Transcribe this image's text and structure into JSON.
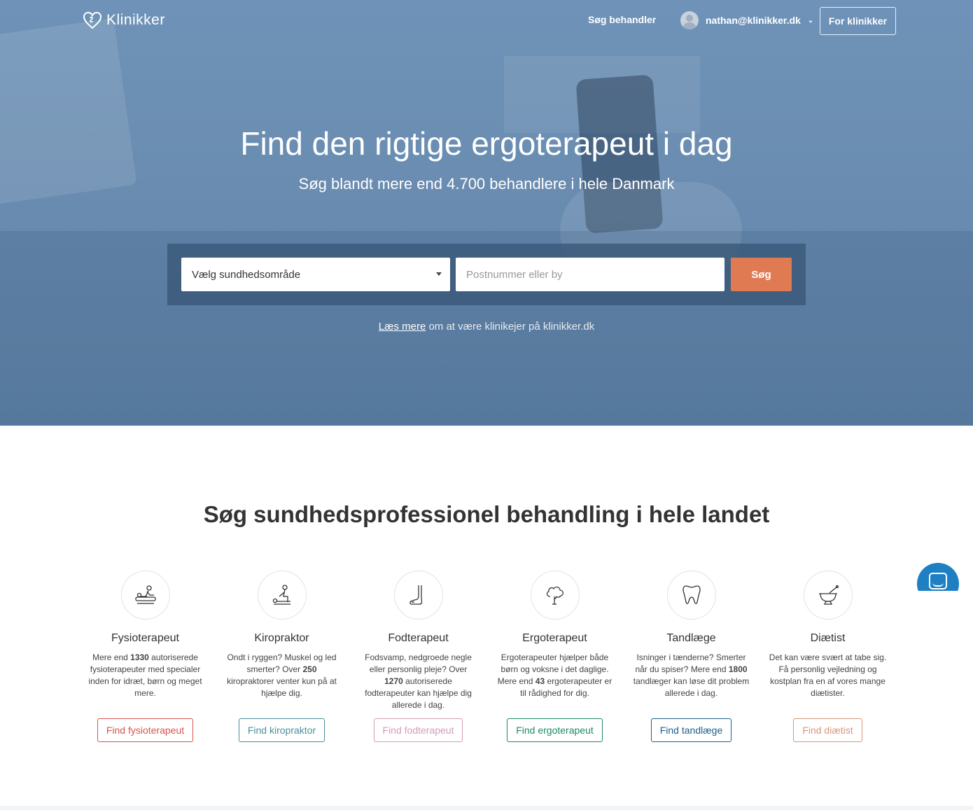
{
  "nav": {
    "logo_text": "Klinikker",
    "search_link": "Søg behandler",
    "user_email": "nathan@klinikker.dk",
    "clinic_button": "For klinikker"
  },
  "hero": {
    "title": "Find den rigtige ergoterapeut i dag",
    "subtitle": "Søg blandt mere end 4.700 behandlere i hele Danmark",
    "select_value": "Vælg sundhedsområde",
    "input_placeholder": "Postnummer eller by",
    "search_button": "Søg",
    "readmore_link": "Læs mere",
    "readmore_text": " om at være klinikejer på klinikker.dk"
  },
  "section": {
    "title": "Søg sundhedsprofessionel behandling i hele landet"
  },
  "cards": [
    {
      "icon": "massage-icon",
      "title": "Fysioterapeut",
      "desc": [
        "Mere end ",
        "1330",
        " autoriserede fysioterapeuter med specialer inden for idræt, børn og meget mere."
      ],
      "button": "Find fysioterapeut",
      "color": "#d9534f"
    },
    {
      "icon": "chiropractor-icon",
      "title": "Kiropraktor",
      "desc": [
        "Ondt i ryggen? Muskel og led smerter? Over ",
        "250",
        " kiropraktorer venter kun på at hjælpe dig."
      ],
      "button": "Find kiropraktor",
      "color": "#4a8f9a"
    },
    {
      "icon": "foot-icon",
      "title": "Fodterapeut",
      "desc": [
        "Fodsvamp, nedgroede negle eller personlig pleje? Over ",
        "1270",
        " autoriserede fodterapeuter kan hjælpe dig allerede i dag."
      ],
      "button": "Find fodterapeut",
      "color": "#d39bb8"
    },
    {
      "icon": "tree-icon",
      "title": "Ergoterapeut",
      "desc": [
        "Ergoterapeuter hjælper både børn og voksne i det daglige. Mere end ",
        "43",
        " ergoterapeuter er til rådighed for dig."
      ],
      "button": "Find ergoterapeut",
      "color": "#1f8a65"
    },
    {
      "icon": "tooth-icon",
      "title": "Tandlæge",
      "desc": [
        "Isninger i tænderne? Smerter når du spiser? Mere end ",
        "1800",
        " tandlæger kan løse dit problem allerede i dag."
      ],
      "button": "Find tandlæge",
      "color": "#1d5f8a"
    },
    {
      "icon": "mortar-pestle-icon",
      "title": "Diætist",
      "desc": [
        "Det kan være svært at tabe sig. Få personlig vejledning og kostplan fra en af vores mange diætister.",
        "",
        ""
      ],
      "button": "Find diætist",
      "color": "#d9957a"
    }
  ],
  "colors": {
    "accent_orange": "#e07a52",
    "chat_blue": "#1f7fc3"
  }
}
